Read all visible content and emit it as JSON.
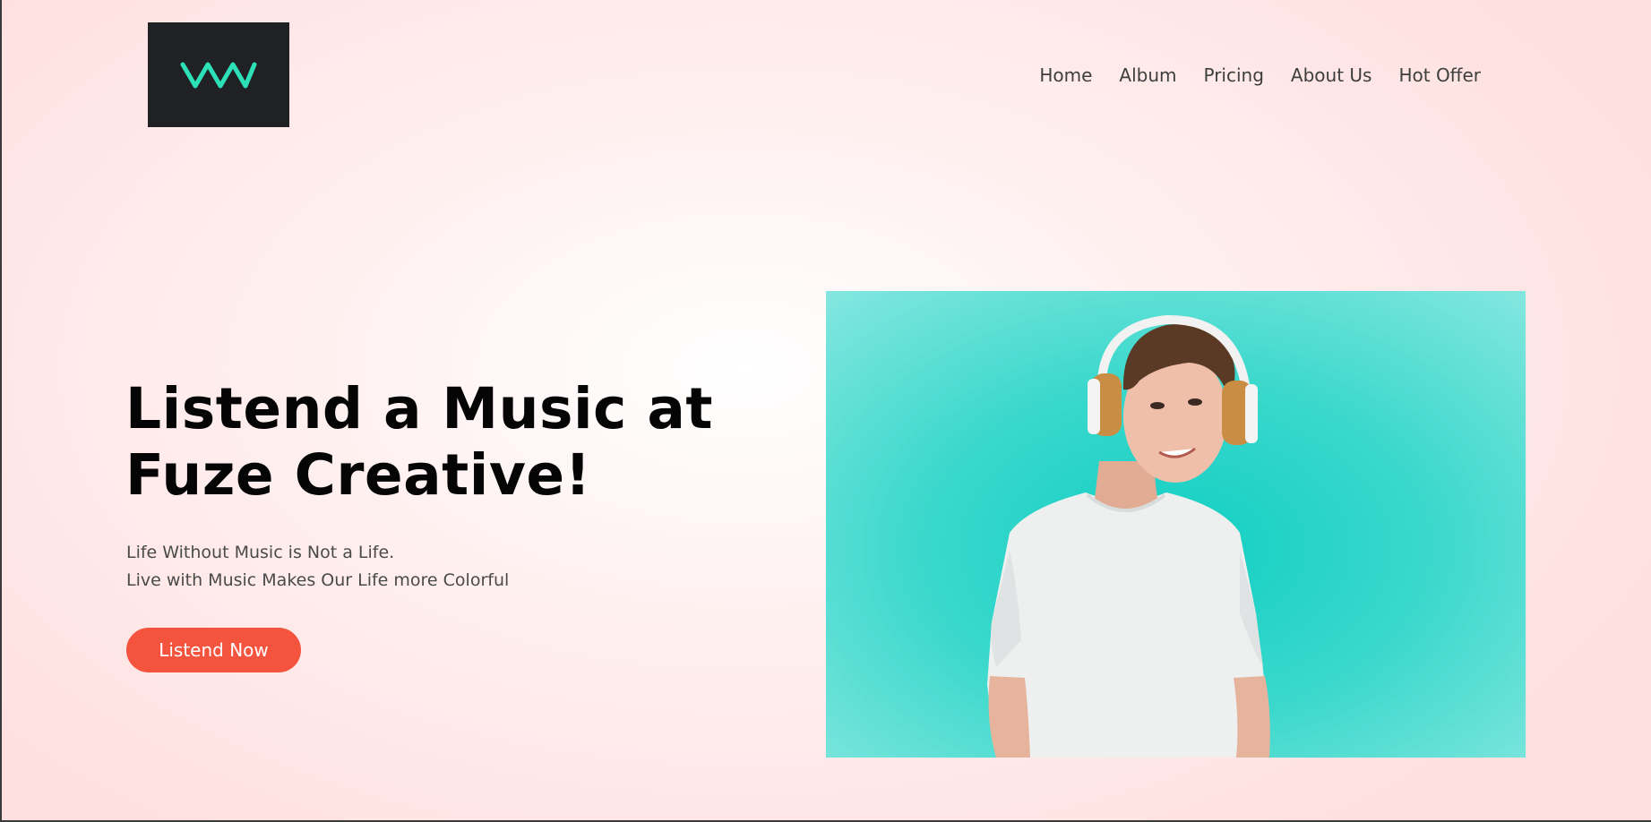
{
  "brand": {
    "logo_icon": "w-logo-icon",
    "logo_bg": "#1f2124",
    "logo_color": "#2de0b8"
  },
  "nav": {
    "items": [
      {
        "label": "Home"
      },
      {
        "label": "Album"
      },
      {
        "label": "Pricing"
      },
      {
        "label": "About Us"
      },
      {
        "label": "Hot Offer"
      }
    ]
  },
  "hero": {
    "title_line1": "Listend a Music at",
    "title_line2": "Fuze Creative!",
    "subtitle_line1": "Life Without Music is Not a Life.",
    "subtitle_line2": "Live with Music Makes Our Life more Colorful",
    "cta_label": "Listend Now",
    "cta_color": "#f4533e",
    "image_bg": "#1fd3c6"
  }
}
